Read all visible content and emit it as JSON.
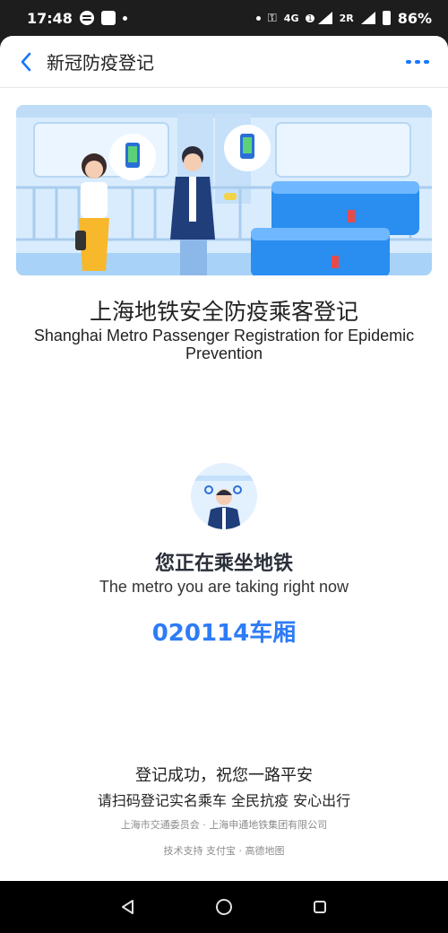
{
  "status_bar": {
    "time": "17:48",
    "network": "4G",
    "sim_badge": "1",
    "roaming": "2R",
    "battery": "86%"
  },
  "header": {
    "title": "新冠防疫登记",
    "back_icon": "chevron-left-icon",
    "more_icon": "more-dots-icon"
  },
  "main": {
    "heading_cn": "上海地铁安全防疫乘客登记",
    "heading_en": "Shanghai Metro Passenger Registration for Epidemic Prevention",
    "status_cn": "您正在乘坐地铁",
    "status_en": "The metro you are taking right now",
    "carriage": "020114车厢"
  },
  "footer": {
    "success": "登记成功，祝您一路平安",
    "slogan": "请扫码登记实名乘车 全民抗疫 安心出行",
    "orgs": "上海市交通委员会 · 上海申通地铁集团有限公司",
    "tech": "技术支持 支付宝 · 高德地图"
  },
  "colors": {
    "accent": "#1677ff",
    "carriage_text": "#2e7cf6",
    "banner_bg": "#dbeeff"
  }
}
